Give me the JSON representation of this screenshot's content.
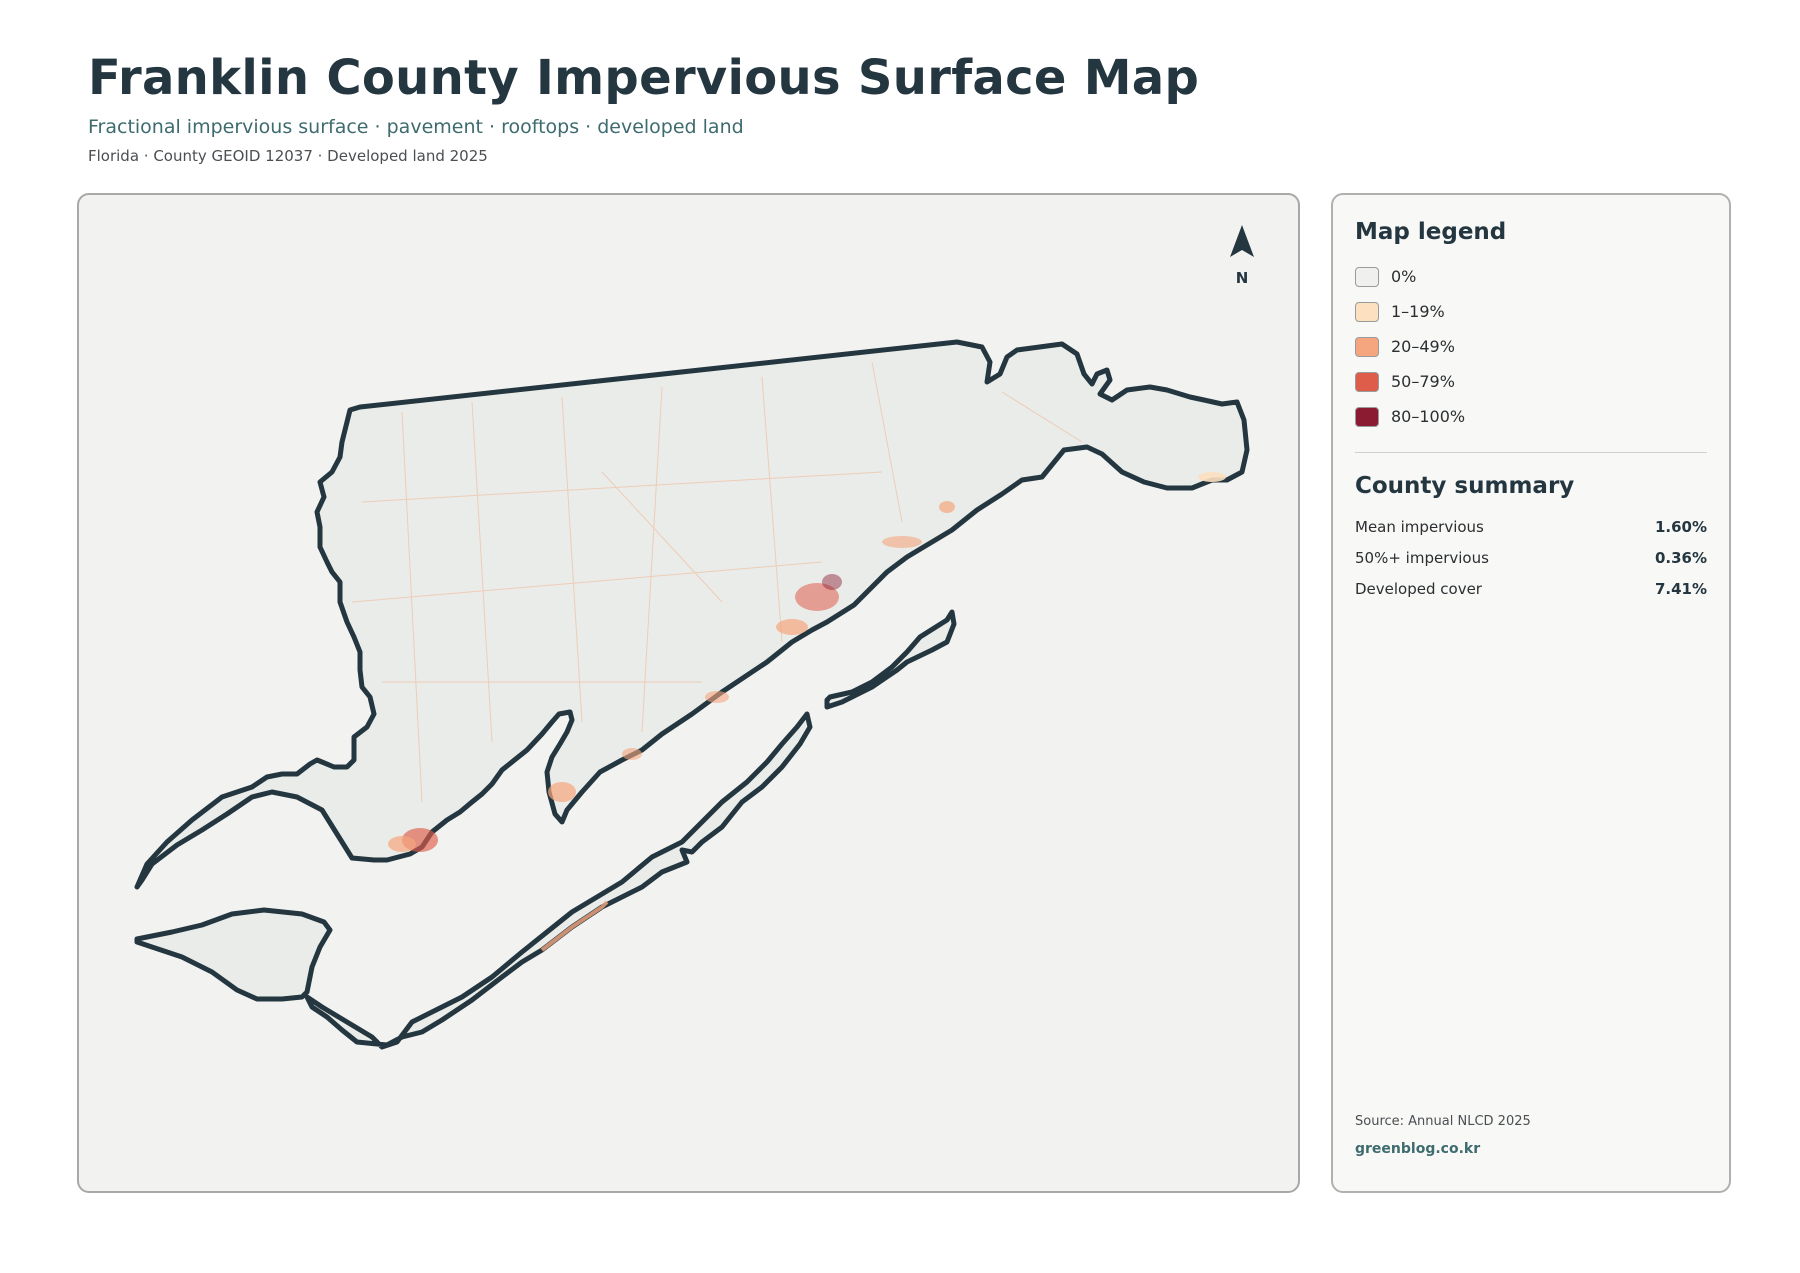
{
  "header": {
    "title": "Franklin County Impervious Surface Map",
    "subtitle": "Fractional impervious surface · pavement · rooftops · developed land",
    "meta": "Florida · County GEOID 12037 · Developed land 2025"
  },
  "map": {
    "north_label": "N",
    "colors": {
      "outline": "#243640",
      "land": "#e9ece8",
      "background": "#f2f2f0"
    }
  },
  "legend": {
    "title": "Map legend",
    "items": [
      {
        "label": "0%",
        "color": "#f0f0ee"
      },
      {
        "label": "1–19%",
        "color": "#fde0c0"
      },
      {
        "label": "20–49%",
        "color": "#f5a67e"
      },
      {
        "label": "50–79%",
        "color": "#de5c4a"
      },
      {
        "label": "80–100%",
        "color": "#8a1b31"
      }
    ]
  },
  "summary": {
    "title": "County summary",
    "rows": [
      {
        "label": "Mean impervious",
        "value": "1.60%"
      },
      {
        "label": "50%+ impervious",
        "value": "0.36%"
      },
      {
        "label": "Developed cover",
        "value": "7.41%"
      }
    ]
  },
  "footer": {
    "source": "Source: Annual NLCD 2025",
    "site": "greenblog.co.kr"
  }
}
